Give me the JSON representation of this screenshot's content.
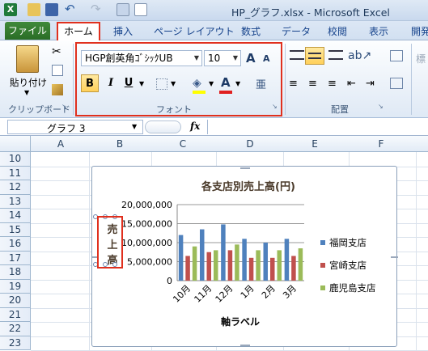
{
  "window": {
    "title": "HP_グラフ.xlsx - Microsoft Excel"
  },
  "tabs": [
    "ファイル",
    "ホーム",
    "挿入",
    "ページ レイアウト",
    "数式",
    "データ",
    "校閲",
    "表示",
    "開発"
  ],
  "ribbon": {
    "clipboard": {
      "paste": "貼り付け",
      "group": "クリップボード"
    },
    "font": {
      "name": "HGP創英角ｺﾞｼｯｸUB",
      "size": "10",
      "bold": "B",
      "italic": "I",
      "underline": "U",
      "group": "フォント",
      "grow": "A",
      "shrink": "A",
      "color_a": "A",
      "phonetic": "亜"
    },
    "align": {
      "group": "配置"
    }
  },
  "formula": {
    "namebox": "グラフ 3",
    "fx": "fx"
  },
  "sheet": {
    "columns": [
      "A",
      "B",
      "C",
      "D",
      "E",
      "F"
    ],
    "rows": [
      "10",
      "11",
      "12",
      "13",
      "14",
      "15",
      "16",
      "17",
      "18",
      "19",
      "20",
      "21",
      "22",
      "23"
    ]
  },
  "chart_data": {
    "type": "bar",
    "title": "各支店別売上高(円)",
    "xlabel": "軸ラベル",
    "ylabel": "売上高",
    "categories": [
      "10月",
      "11月",
      "12月",
      "1月",
      "2月",
      "3月"
    ],
    "series": [
      {
        "name": "福岡支店",
        "color": "#4f81bd",
        "values": [
          12000000,
          13500000,
          14800000,
          11000000,
          10000000,
          11000000
        ]
      },
      {
        "name": "宮崎支店",
        "color": "#c0504d",
        "values": [
          6500000,
          7500000,
          8000000,
          6000000,
          6000000,
          6500000
        ]
      },
      {
        "name": "鹿児島支店",
        "color": "#9bbb59",
        "values": [
          9000000,
          8000000,
          9500000,
          8000000,
          8000000,
          8500000
        ]
      }
    ],
    "yticks": [
      "20,000,000",
      "15,000,000",
      "10,000,000",
      "5,000,000",
      "0"
    ],
    "ylim": [
      0,
      20000000
    ],
    "grid": true,
    "legend": "right"
  }
}
